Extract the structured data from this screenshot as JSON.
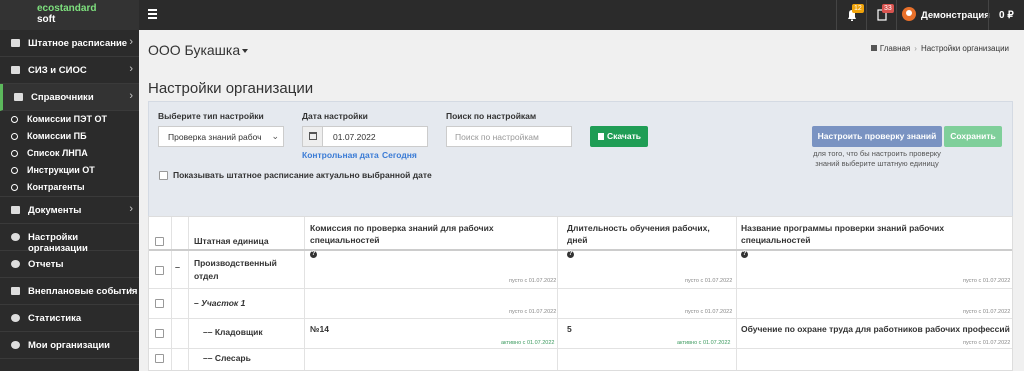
{
  "brand": {
    "line1": "ecostandard",
    "line2": "soft"
  },
  "topbar": {
    "bell_badge": "12",
    "doc_badge": "33",
    "user_name": "Демонстрация",
    "balance": "0 ₽"
  },
  "sidebar": {
    "items": [
      {
        "label": "Штатное расписание",
        "chevron": "›"
      },
      {
        "label": "СИЗ и СИОС",
        "chevron": "›"
      },
      {
        "label": "Справочники",
        "chevron": "›"
      }
    ],
    "subitems": [
      "Комиссии ПЭТ ОТ",
      "Комиссии ПБ",
      "Список ЛНПА",
      "Инструкции ОТ",
      "Контрагенты"
    ],
    "items2": [
      {
        "label": "Документы",
        "chevron": "›"
      },
      {
        "label": "Настройки организации",
        "chevron": ""
      },
      {
        "label": "Отчеты",
        "chevron": ""
      },
      {
        "label": "Внеплановые события",
        "chevron": "›"
      },
      {
        "label": "Статистика",
        "chevron": ""
      },
      {
        "label": "Мои организации",
        "chevron": ""
      }
    ]
  },
  "header": {
    "org_name": "ООО Букашка",
    "breadcrumb_home": "Главная",
    "breadcrumb_current": "Настройки организации",
    "page_title": "Настройки организации"
  },
  "filters": {
    "type_label": "Выберите тип настройки",
    "type_value": "Проверка знаний рабоч",
    "date_label": "Дата настройки",
    "date_value": "01.07.2022",
    "control_date_link": "Контрольная дата",
    "today_link": "Сегодня",
    "search_label": "Поиск по настройкам",
    "search_placeholder": "Поиск по настройкам",
    "download_button": "Скачать",
    "show_actual_label": "Показывать штатное расписание актуально выбранной дате",
    "configure_button": "Настроить проверку знаний",
    "save_button": "Сохранить",
    "hint": "для того, что бы настроить проверку знаний выберите штатную единицу"
  },
  "table": {
    "headers": {
      "unit": "Штатная единица",
      "commission": "Комиссия по проверка знаний для рабочих специальностей",
      "duration": "Длительность обучения рабочих, дней",
      "program": "Название программы проверки знаний рабочих специальностей"
    },
    "rows": [
      {
        "unit": "Производственный отдел",
        "commission": "",
        "commission_status": "пусто с 01.07.2022",
        "duration": "",
        "duration_status": "пусто с 01.07.2022",
        "program": "",
        "program_status": "пусто с 01.07.2022"
      },
      {
        "unit": "Участок 1",
        "commission": "",
        "commission_status": "пусто с 01.07.2022",
        "duration": "",
        "duration_status": "пусто с 01.07.2022",
        "program": "",
        "program_status": "пусто с 01.07.2022"
      },
      {
        "unit": "Кладовщик",
        "commission": "№14",
        "commission_status": "активно с 01.07.2022",
        "duration": "5",
        "duration_status": "активно с 01.07.2022",
        "program": "Обучение по охране труда для работников рабочих профессий",
        "program_status": "пусто с 01.07.2022"
      },
      {
        "unit": "Слесарь",
        "commission": "",
        "commission_status": "",
        "duration": "",
        "duration_status": "",
        "program": "",
        "program_status": ""
      }
    ]
  }
}
